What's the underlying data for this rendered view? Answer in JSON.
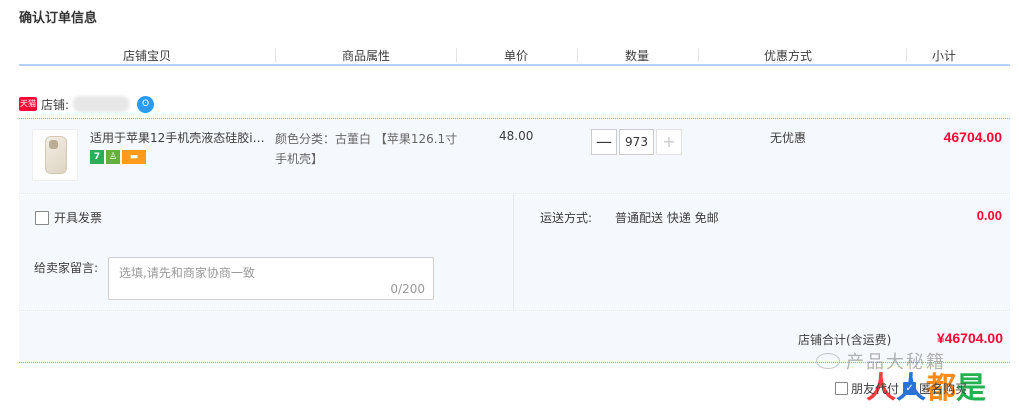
{
  "page": {
    "title": "确认订单信息"
  },
  "columns": [
    "店铺宝贝",
    "商品属性",
    "单价",
    "数量",
    "优惠方式",
    "小计"
  ],
  "shop": {
    "badge": "天猫",
    "label": "店铺:",
    "ww_icon": "wangwang-chat-icon"
  },
  "item": {
    "title": "适用于苹果12手机壳液态硅胶ip…",
    "service_icons": [
      "seven-day-return-icon",
      "insurance-icon",
      "credit-card-icon"
    ],
    "seven_day_label": "7",
    "attr": "颜色分类：古董白 【苹果126.1寸手机壳】",
    "price": "48.00",
    "quantity": "973",
    "promo": "无优惠",
    "subtotal": "46704.00"
  },
  "options": {
    "invoice_label": "开具发票",
    "message_label": "给卖家留言:",
    "message_placeholder": "选填,请先和商家协商一致",
    "message_count": "0/200",
    "shipping_label": "运送方式:",
    "shipping_value": "普通配送 快递 免邮",
    "shipping_fee": "0.00"
  },
  "total": {
    "label": "店铺合计(含运费)",
    "value": "¥46704.00"
  },
  "footer": {
    "friend_pay_label": "朋友代付",
    "anonymous_label": "匿名购买"
  },
  "watermark": {
    "text": "产品大秘籍",
    "logo": [
      "人",
      "人",
      "都",
      "是"
    ]
  },
  "colors": {
    "accent_red": "#ff0036",
    "row_bg": "#f5f8fd",
    "header_border": "#b2d1ff"
  }
}
